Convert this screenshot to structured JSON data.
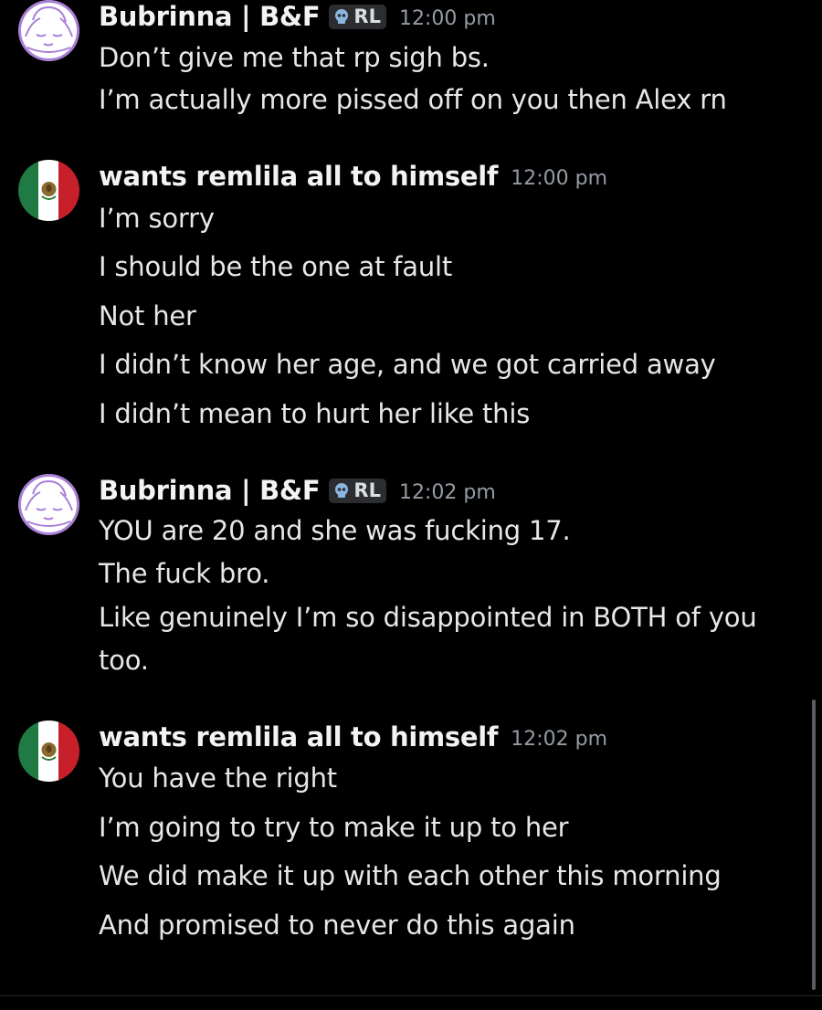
{
  "colors": {
    "background": "#000000",
    "username": "#f2f3f5",
    "text": "#e6e7ea",
    "timestamp": "#949ba4",
    "tag_bg": "#2b2d31",
    "avatar_purple": "#a97fd6",
    "flag_green": "#1f7a43",
    "flag_red": "#c8202b"
  },
  "messages": [
    {
      "author": "Bubrinna | B&F",
      "tag": "RL",
      "tag_icon": "skull-icon",
      "time": "12:00 pm",
      "avatar_icon": "sleepy-face-avatar",
      "lines": [
        "Don’t give me that rp sigh bs.",
        "I’m actually more pissed off on you then Alex rn"
      ]
    },
    {
      "author": "wants remlila all to himself",
      "time": "12:00 pm",
      "avatar_icon": "mexico-flag-avatar",
      "lines": [
        "I’m sorry",
        "I should be the one at fault",
        "Not her",
        "I didn’t know her age, and we got carried away",
        "I didn’t mean to hurt her like this"
      ]
    },
    {
      "author": "Bubrinna | B&F",
      "tag": "RL",
      "tag_icon": "skull-icon",
      "time": "12:02 pm",
      "avatar_icon": "sleepy-face-avatar",
      "lines": [
        "YOU are 20 and she was fucking 17.",
        "The fuck bro.",
        "Like genuinely I’m so disappointed in BOTH of you",
        "too."
      ]
    },
    {
      "author": "wants remlila all to himself",
      "time": "12:02 pm",
      "avatar_icon": "mexico-flag-avatar",
      "lines": [
        "You have the right",
        "I’m going to try to make it up to her",
        "We did make it up with each other this morning",
        "And promised to never do this again"
      ]
    }
  ]
}
